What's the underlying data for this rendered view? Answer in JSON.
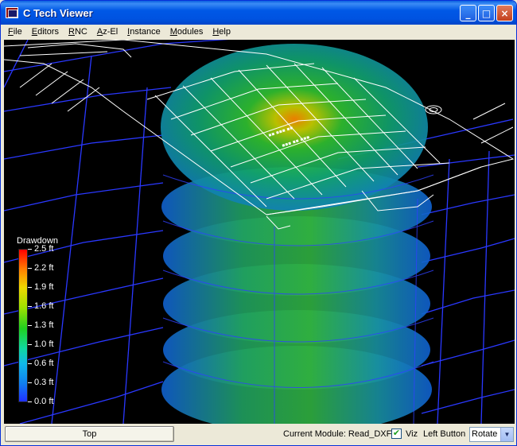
{
  "window": {
    "title": "C Tech Viewer",
    "controls": {
      "minimize": "_",
      "maximize": "□",
      "close": "×"
    }
  },
  "menu": [
    "File",
    "Editors",
    "RNC",
    "Az-El",
    "Instance",
    "Modules",
    "Help"
  ],
  "legend": {
    "title": "Drawdown",
    "ticks": [
      "2.5 ft",
      "2.2 ft",
      "1.9 ft",
      "1.6 ft",
      "1.3 ft",
      "1.0 ft",
      "0.6 ft",
      "0.3 ft",
      "0.0 ft"
    ]
  },
  "status": {
    "view_button": "Top",
    "current_module": "Current Module: Read_DXF",
    "viz_checked": true,
    "viz_label": "Viz",
    "left_button_label": "Left Button",
    "left_button_mode": "Rotate"
  },
  "colors": {
    "title_bar": "#0058E6",
    "viewport_bg": "#000000",
    "grid_lines": "#2030ff",
    "cad_lines": "#ffffff"
  }
}
